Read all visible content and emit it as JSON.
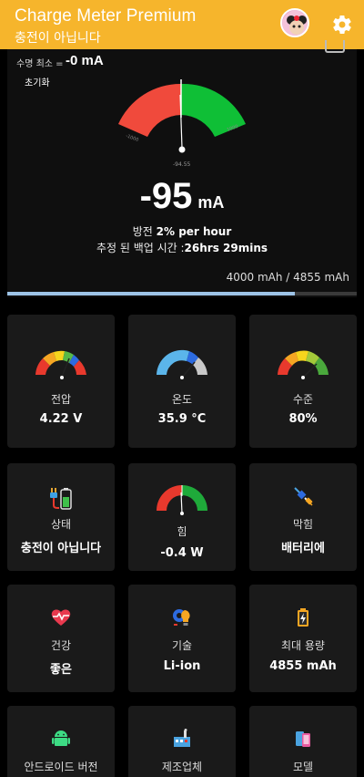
{
  "app": {
    "title": "Charge Meter Premium",
    "subtitle": "충전이 아닙니다"
  },
  "main": {
    "lifetime_label": "수명 최소 =",
    "lifetime_value": "-0 mA",
    "reset_label": "초기화",
    "gauge_left_tick": "-1000",
    "gauge_right_tick": "1000",
    "gauge_needle_label": "-94.55",
    "current_value": "-95",
    "current_unit": "mA",
    "discharge_prefix": "방전 ",
    "discharge_rate": "2% per hour",
    "backup_prefix": "추정 된 백업 시간 :",
    "backup_time": "26hrs 29mins",
    "capacity_text": "4000 mAh / 4855 mAh",
    "capacity_progress": 0.824
  },
  "cards": {
    "voltage": {
      "label": "전압",
      "value": "4.22 V"
    },
    "temperature": {
      "label": "온도",
      "value": "35.9 °C"
    },
    "level": {
      "label": "수준",
      "value": "80%"
    },
    "status": {
      "label": "상태",
      "value": "충전이 아닙니다"
    },
    "power": {
      "label": "힘",
      "value": "-0.4 W"
    },
    "plugged": {
      "label": "막힘",
      "value": "배터리에"
    },
    "health": {
      "label": "건강",
      "value": "좋은"
    },
    "technology": {
      "label": "기술",
      "value": "Li-ion"
    },
    "capacity": {
      "label": "최대 용량",
      "value": "4855 mAh"
    },
    "android": {
      "label": "안드로이드 버전"
    },
    "manufacturer": {
      "label": "제조업체"
    },
    "model": {
      "label": "모델"
    }
  },
  "colors": {
    "appbar": "#f6b52c",
    "gauge_red": "#f04a3c",
    "gauge_green": "#0fbf36",
    "progress": "#9dc3e6"
  },
  "icons": [
    "settings-gear-icon",
    "avatar-icon",
    "battery-plug-icon",
    "plug-icon",
    "heart-pulse-icon",
    "gear-bulb-icon",
    "battery-charging-icon",
    "android-icon",
    "factory-icon",
    "phone-icon"
  ]
}
